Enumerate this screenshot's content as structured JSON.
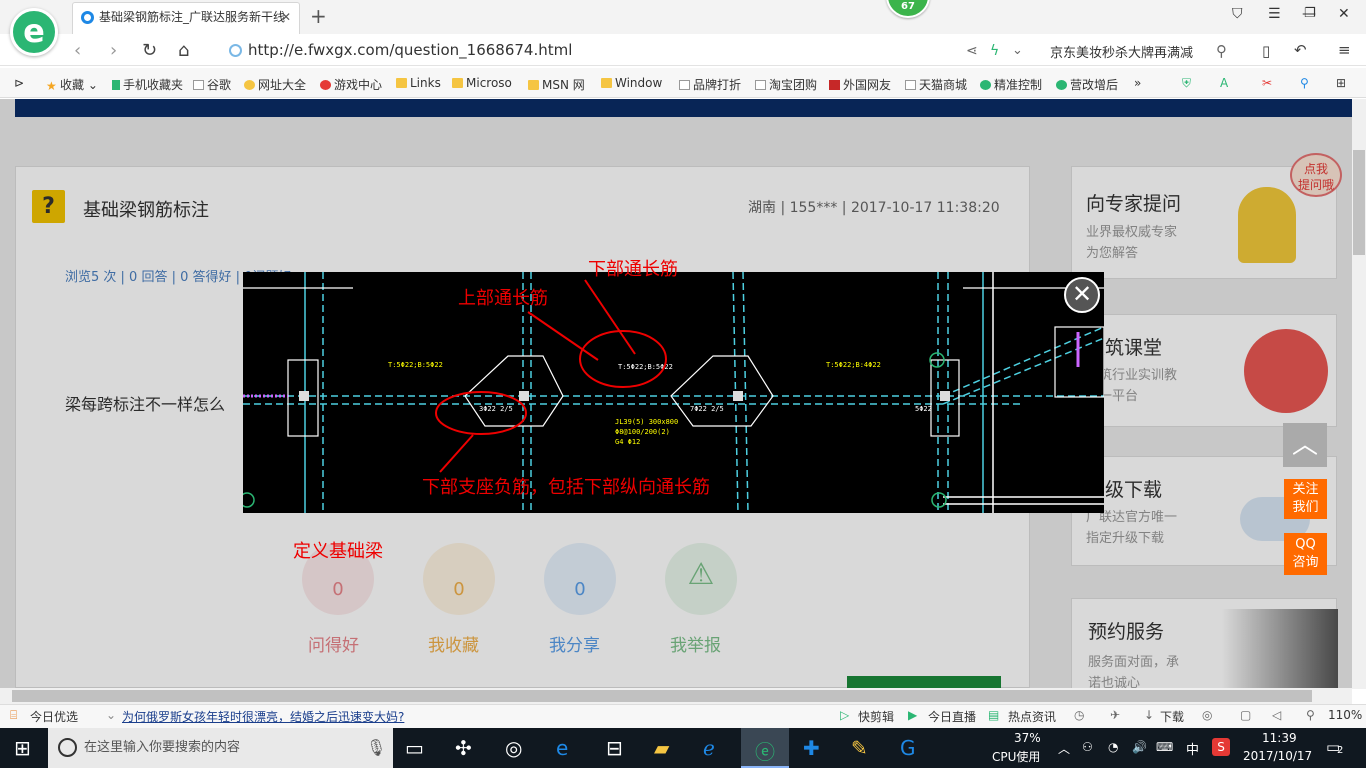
{
  "browser": {
    "tab_title": "基础梁钢筋标注_广联达服务新干线",
    "badge_count": "67",
    "url": "http://e.fwxgx.com/question_1668674.html",
    "search_hint": "京东美妆秒杀大牌再满减"
  },
  "bookmarks": [
    "收藏",
    "手机收藏夹",
    "谷歌",
    "网址大全",
    "游戏中心",
    "Links",
    "Microso",
    "MSN 网",
    "Window",
    "品牌打折",
    "淘宝团购",
    "外国网友",
    "天猫商城",
    "精准控制",
    "营改增后"
  ],
  "question": {
    "title": "基础梁钢筋标注",
    "meta": "湖南 | 155*** | 2017-10-17 11:38:20",
    "stats": "浏览5 次 | 0 回答 | 0 答得好 | 0问题好",
    "text": "梁每跨标注不一样怎么",
    "actions": [
      {
        "label": "问得好",
        "count": "0",
        "color": "#e8848a",
        "bg": "#fbe9ea"
      },
      {
        "label": "我收藏",
        "count": "0",
        "color": "#f0b04a",
        "bg": "#fdf3e1"
      },
      {
        "label": "我分享",
        "count": "0",
        "color": "#5a9ee8",
        "bg": "#e6f0fb"
      },
      {
        "label": "我举报",
        "count": "",
        "color": "#7cc08a",
        "bg": "#e8f5ea"
      }
    ]
  },
  "sidebar": {
    "expert": {
      "title": "向专家提问",
      "sub1": "业界最权威专家",
      "sub2": "为您解答",
      "bubble": "点我\n提问哦"
    },
    "course": {
      "title": "建筑课堂",
      "sub1": "建筑行业实训教",
      "sub2": "第一平台"
    },
    "upgrade": {
      "title": "升级下载",
      "sub1": "广联达官方唯一",
      "sub2": "指定升级下载"
    },
    "service": {
      "title": "预约服务",
      "sub1": "服务面对面，承",
      "sub2": "诺也诚心"
    }
  },
  "floating": {
    "follow": "关注\n我们",
    "qq": "QQ\n咨询"
  },
  "modal": {
    "annotations": {
      "lower_through": "下部通长筋",
      "upper_through": "上部通长筋",
      "support_neg": "下部支座负筋，包括下部纵向通长筋",
      "define_beam": "定义基础梁"
    },
    "cad_labels": [
      "T:5Φ22;B:5Φ22",
      "T:5Φ22;B:4Φ22",
      "3Φ22 2/5",
      "7Φ22 2/5",
      "5Φ22",
      "JL39(5) 300x800",
      "Φ8@100/200(2)",
      "G4 Φ12"
    ]
  },
  "statusbar": {
    "news_left": "今日优选",
    "headline": "为何俄罗斯女孩年轻时很漂亮，结婚之后迅速变大妈?",
    "items": [
      "快剪辑",
      "今日直播",
      "热点资讯",
      "下载"
    ],
    "zoom": "110%"
  },
  "taskbar": {
    "search_placeholder": "在这里输入你要搜索的内容",
    "cpu": "37%",
    "cpu_label": "CPU使用",
    "ime": "中",
    "time": "11:39",
    "date": "2017/10/17",
    "notif": "2"
  }
}
